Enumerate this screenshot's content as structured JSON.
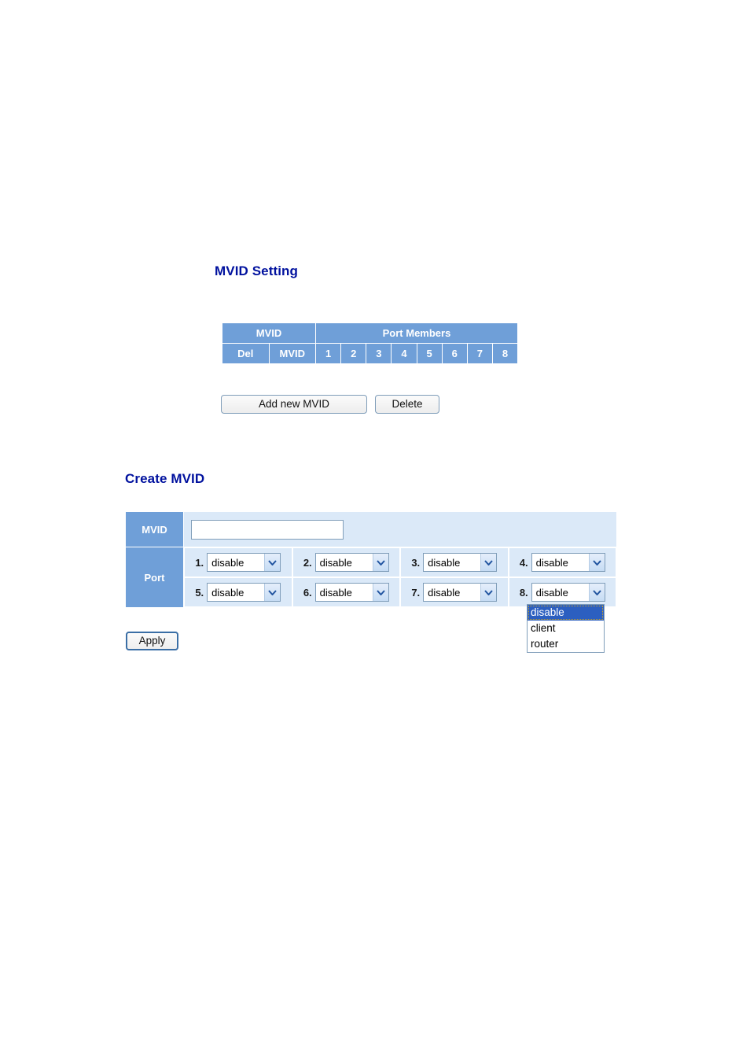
{
  "mvid_setting": {
    "heading": "MVID Setting",
    "table": {
      "group_headers": [
        {
          "label": "MVID",
          "span": 2
        },
        {
          "label": "Port Members",
          "span": 8
        }
      ],
      "column_headers": [
        "Del",
        "MVID",
        "1",
        "2",
        "3",
        "4",
        "5",
        "6",
        "7",
        "8"
      ],
      "rows": []
    },
    "buttons": {
      "add_new_mvid": "Add new MVID",
      "delete": "Delete"
    }
  },
  "create_mvid": {
    "heading": "Create MVID",
    "mvid_row_label": "MVID",
    "mvid_value": "",
    "mvid_placeholder": "",
    "port_row_label": "Port",
    "ports": [
      {
        "num": "1.",
        "value": "disable"
      },
      {
        "num": "2.",
        "value": "disable"
      },
      {
        "num": "3.",
        "value": "disable"
      },
      {
        "num": "4.",
        "value": "disable"
      },
      {
        "num": "5.",
        "value": "disable"
      },
      {
        "num": "6.",
        "value": "disable"
      },
      {
        "num": "7.",
        "value": "disable"
      },
      {
        "num": "8.",
        "value": "disable"
      }
    ],
    "open_dropdown": {
      "owner_port": "8.",
      "options": [
        "disable",
        "client",
        "router"
      ],
      "selected": "disable"
    },
    "apply_button": "Apply"
  },
  "colors": {
    "heading_text": "#00119e",
    "header_blue": "#6f9fd8",
    "cell_bg": "#dbe9f8",
    "select_highlight": "#2c5fc0",
    "control_border": "#7f9db9"
  }
}
